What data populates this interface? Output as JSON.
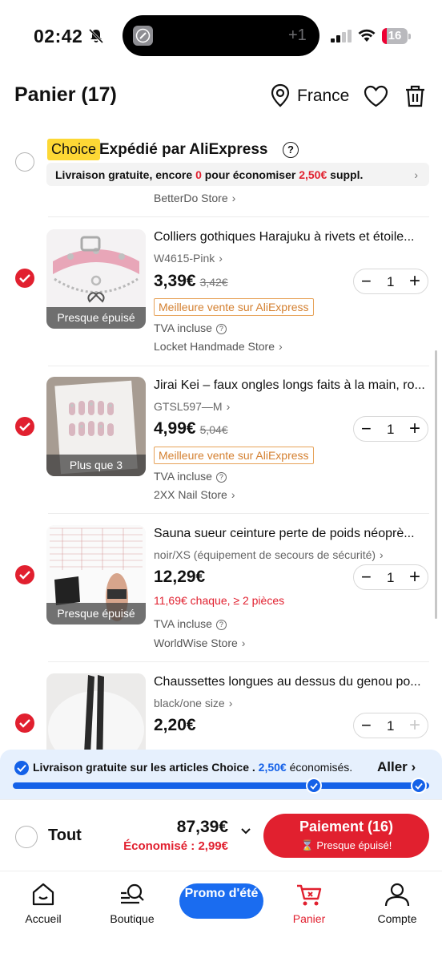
{
  "status_bar": {
    "time": "02:42",
    "island_plus": "+1",
    "battery": "16"
  },
  "header": {
    "title": "Panier (17)",
    "location": "France"
  },
  "choice_section": {
    "tag": "Choice",
    "title": "Expédié par AliExpress",
    "shipping_prefix": "Livraison gratuite, encore ",
    "shipping_amount": "0",
    "shipping_mid": " pour économiser ",
    "shipping_saving": "2,50€",
    "shipping_suffix": " suppl.",
    "prev_store": "BetterDo Store"
  },
  "products": [
    {
      "title": "Colliers gothiques Harajuku à rivets et étoile...",
      "variant": "W4615-Pink",
      "price": "3,39€",
      "old_price": "3,42€",
      "tag": "Meilleure vente sur AliExpress",
      "tva": "TVA incluse",
      "store": "Locket Handmade Store",
      "badge": "Presque épuisé",
      "qty": "1",
      "selected": true
    },
    {
      "title": "Jirai Kei – faux ongles longs faits à la main, ro...",
      "variant": "GTSL597—M",
      "price": "4,99€",
      "old_price": "5,04€",
      "tag": "Meilleure vente sur AliExpress",
      "tva": "TVA incluse",
      "store": "2XX Nail Store",
      "badge": "Plus que 3",
      "qty": "1",
      "selected": true
    },
    {
      "title": "Sauna sueur ceinture perte de poids néoprè...",
      "variant": "noir/XS (équipement de secours de sécurité)",
      "price": "12,29€",
      "bulk": "11,69€ chaque, ≥ 2 pièces",
      "tva": "TVA incluse",
      "store": "WorldWise Store",
      "badge": "Presque épuisé",
      "qty": "1",
      "selected": true
    },
    {
      "title": "Chaussettes longues au dessus du genou po...",
      "variant": "black/one size",
      "price": "2,20€",
      "qty": "1",
      "selected": true
    }
  ],
  "promo_banner": {
    "text": "Livraison gratuite sur les articles Choice . ",
    "amount": "2,50€",
    "suffix": " économisés.",
    "action": "Aller"
  },
  "checkout": {
    "all_label": "Tout",
    "total": "87,39€",
    "saved": "Économisé : 2,99€",
    "pay_label": "Paiement (16)",
    "pay_sub": "⌛ Presque épuisé!"
  },
  "bottom_nav": {
    "home": "Accueil",
    "shop": "Boutique",
    "promo": "Promo d'été",
    "cart": "Panier",
    "account": "Compte"
  },
  "colors": {
    "accent": "#e1202f",
    "blue": "#1461e8",
    "choice_yellow": "#fdd835"
  }
}
